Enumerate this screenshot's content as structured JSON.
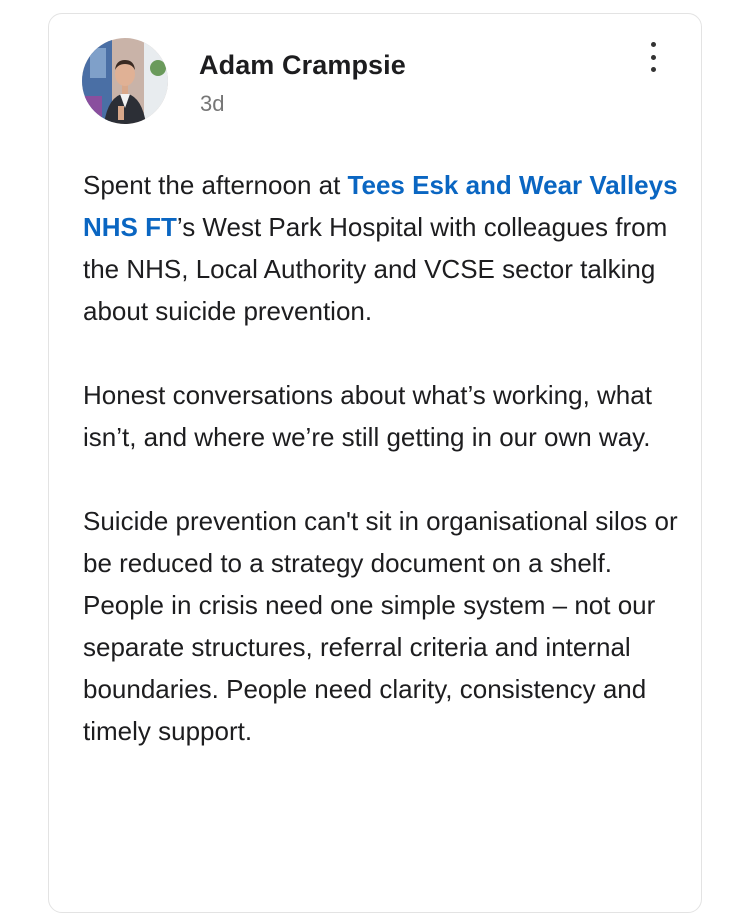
{
  "post": {
    "author": "Adam Crampsie",
    "time": "3d",
    "menu_icon": "more-vertical-icon",
    "avatar": "avatar",
    "paragraph1": {
      "before": "Spent the afternoon at ",
      "mention": "Tees Esk and Wear Valleys NHS FT",
      "after": "’s West Park Hospital with colleagues from the NHS, Local Authority and VCSE sector talking about suicide prevention."
    },
    "paragraph2": "Honest conversations about what’s working, what isn’t, and where we’re still getting in our own way.",
    "paragraph3": "Suicide prevention can't sit in organisational silos or be reduced to a strategy document on a shelf. People in crisis need one simple system – not our separate structures, referral criteria and internal boundaries. People need clarity, consistency and timely support.",
    "colors": {
      "mention": "#0a66c2",
      "text": "#1d1d1f",
      "muted": "#767676",
      "border": "#e3e3e3"
    }
  }
}
